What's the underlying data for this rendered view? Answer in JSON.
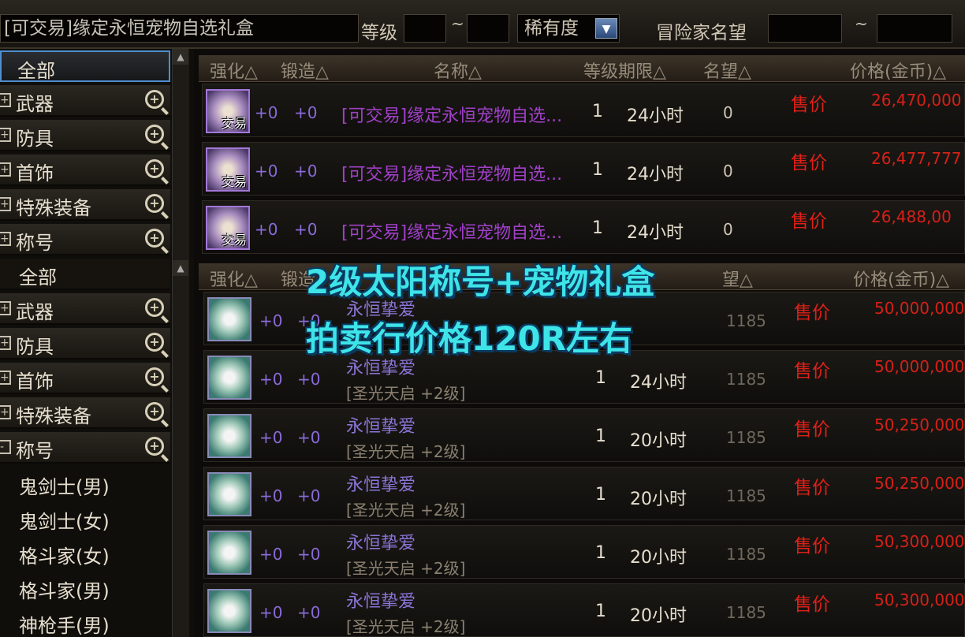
{
  "search": {
    "value": "[可交易]缘定永恒宠物自选礼盒"
  },
  "filters": {
    "level_label": "等级",
    "tilde": "~",
    "rarity_value": "稀有度",
    "fame_label": "冒险家名望"
  },
  "sidebar_top": {
    "all": "全部",
    "items": [
      "武器",
      "防具",
      "首饰",
      "特殊装备",
      "称号"
    ]
  },
  "sidebar_bottom": {
    "all": "全部",
    "items": [
      "武器",
      "防具",
      "首饰",
      "特殊装备",
      "称号"
    ],
    "title_subitems": [
      "鬼剑士(男)",
      "鬼剑士(女)",
      "格斗家(女)",
      "格斗家(男)",
      "神枪手(男)"
    ]
  },
  "header_top": {
    "col_enhance": "强化△",
    "col_forge": "锻造△",
    "col_name": "名称△",
    "col_level_limit": "等级期限△",
    "col_fame": "名望△",
    "col_price": "价格(金币)△"
  },
  "header_bottom": {
    "col_enhance": "强化△",
    "col_forge": "锻造",
    "col_fame": "望△",
    "col_price": "价格(金币)△"
  },
  "top_rows": [
    {
      "tag": "交易",
      "enhance": "+0",
      "forge": "+0",
      "name": "[可交易]缘定永恒宠物自选...",
      "level": "1",
      "period": "24小时",
      "fame": "0",
      "sell": "售价",
      "price": "26,470,000"
    },
    {
      "tag": "交易",
      "enhance": "+0",
      "forge": "+0",
      "name": "[可交易]缘定永恒宠物自选...",
      "level": "1",
      "period": "24小时",
      "fame": "0",
      "sell": "售价",
      "price": "26,477,777"
    },
    {
      "tag": "交易",
      "enhance": "+0",
      "forge": "+0",
      "name": "[可交易]缘定永恒宠物自选...",
      "level": "1",
      "period": "24小时",
      "fame": "0",
      "sell": "售价",
      "price": "26,488,00"
    }
  ],
  "bottom_rows": [
    {
      "enhance": "+0",
      "forge": "+0",
      "name": "永恒挚爱",
      "subname": "",
      "level": "",
      "period": "",
      "fame": "1185",
      "sell": "售价",
      "price": "50,000,000"
    },
    {
      "enhance": "+0",
      "forge": "+0",
      "name": "永恒挚爱",
      "subname": "[圣光天启 +2级]",
      "level": "1",
      "period": "24小时",
      "fame": "1185",
      "sell": "售价",
      "price": "50,000,000"
    },
    {
      "enhance": "+0",
      "forge": "+0",
      "name": "永恒挚爱",
      "subname": "[圣光天启 +2级]",
      "level": "1",
      "period": "20小时",
      "fame": "1185",
      "sell": "售价",
      "price": "50,250,000"
    },
    {
      "enhance": "+0",
      "forge": "+0",
      "name": "永恒挚爱",
      "subname": "[圣光天启 +2级]",
      "level": "1",
      "period": "20小时",
      "fame": "1185",
      "sell": "售价",
      "price": "50,250,000"
    },
    {
      "enhance": "+0",
      "forge": "+0",
      "name": "永恒挚爱",
      "subname": "[圣光天启 +2级]",
      "level": "1",
      "period": "20小时",
      "fame": "1185",
      "sell": "售价",
      "price": "50,300,000"
    },
    {
      "enhance": "+0",
      "forge": "+0",
      "name": "永恒挚爱",
      "subname": "[圣光天启 +2级]",
      "level": "1",
      "period": "20小时",
      "fame": "1185",
      "sell": "售价",
      "price": "50,300,000"
    }
  ],
  "overlay": {
    "line1": "2级太阳称号+宠物礼盒",
    "line2": "拍卖行价格120R左右"
  },
  "colors": {
    "overlay_text": "#3ee4e8",
    "price_red": "#d62018",
    "item_purple": "#a040c8",
    "selected_border": "#4e8fd0"
  },
  "icons": {
    "zoom": "magnifier-plus-icon",
    "expand": "expand-plus-icon",
    "dropdown": "dropdown-arrow-icon"
  }
}
